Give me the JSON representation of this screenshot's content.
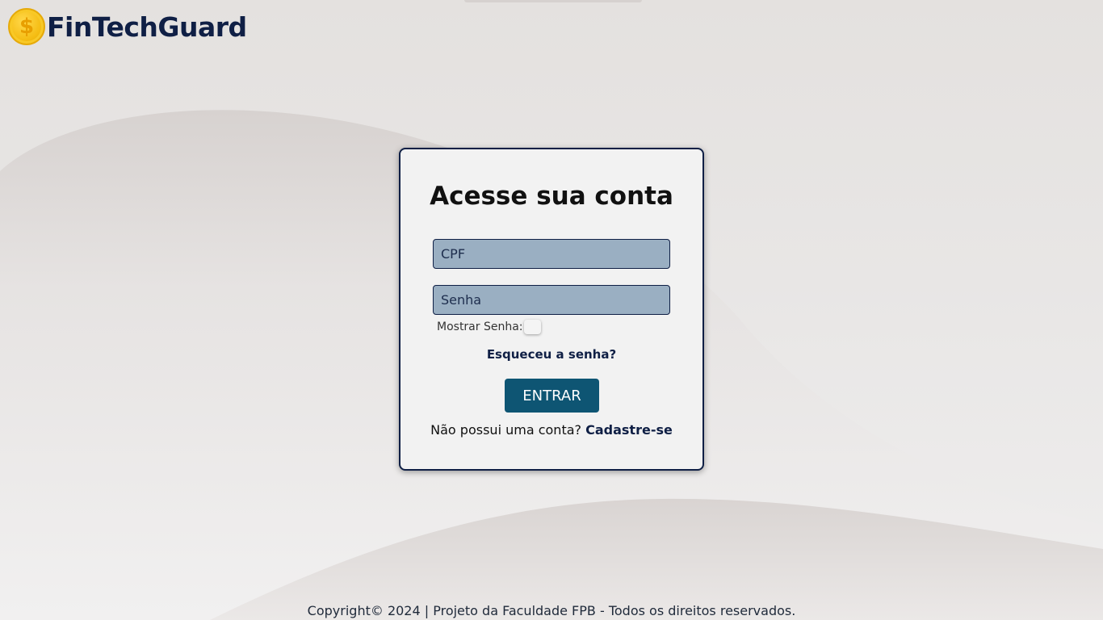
{
  "brand": {
    "name": "FinTechGuard",
    "logo_symbol": "$",
    "logo_icon": "coin-dollar-icon"
  },
  "login": {
    "title": "Acesse sua conta",
    "cpf_placeholder": "CPF",
    "password_placeholder": "Senha",
    "show_password_label": "Mostrar Senha:",
    "show_password_checked": false,
    "forgot_link": "Esqueceu a senha?",
    "submit_label": "ENTRAR",
    "no_account_text": "Não possui uma conta?",
    "signup_link": "Cadastre-se"
  },
  "footer": {
    "text": "Copyright© 2024 | Projeto da Faculdade FPB - Todos os direitos reservados."
  },
  "colors": {
    "brand_navy": "#0f1f45",
    "button_blue": "#0e5573",
    "input_bg": "#9aafc2",
    "coin_gold": "#f5bd14",
    "card_bg": "#f2f2f2"
  }
}
